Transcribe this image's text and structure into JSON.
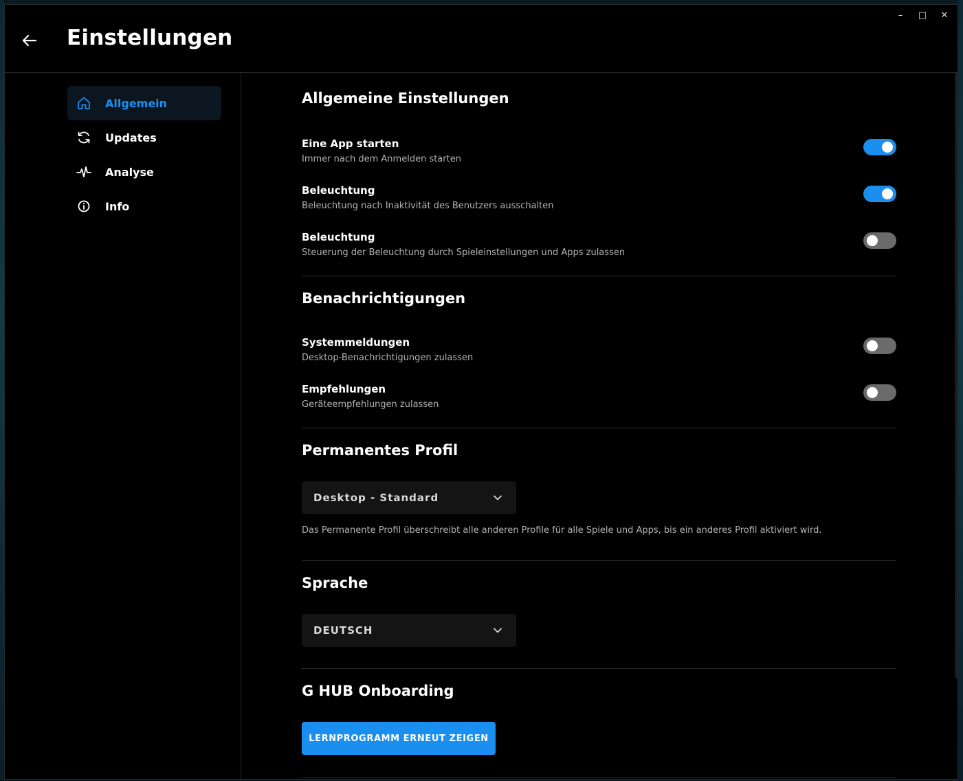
{
  "window": {
    "controls": {
      "minimize": "–",
      "maximize": "□",
      "close": "✕"
    }
  },
  "header": {
    "back_icon": "arrow-left-icon",
    "title": "Einstellungen"
  },
  "sidebar": {
    "items": [
      {
        "label": "Allgemein",
        "icon": "home-icon",
        "active": true
      },
      {
        "label": "Updates",
        "icon": "refresh-icon",
        "active": false
      },
      {
        "label": "Analyse",
        "icon": "pulse-icon",
        "active": false
      },
      {
        "label": "Info",
        "icon": "info-icon",
        "active": false
      }
    ]
  },
  "general": {
    "title": "Allgemeine Einstellungen",
    "settings": [
      {
        "label": "Eine App starten",
        "description": "Immer nach dem Anmelden starten",
        "enabled": true
      },
      {
        "label": "Beleuchtung",
        "description": "Beleuchtung nach Inaktivität des Benutzers ausschalten",
        "enabled": true
      },
      {
        "label": "Beleuchtung",
        "description": "Steuerung der Beleuchtung durch Spieleinstellungen und Apps zulassen",
        "enabled": false
      }
    ]
  },
  "notifications": {
    "title": "Benachrichtigungen",
    "settings": [
      {
        "label": "Systemmeldungen",
        "description": "Desktop-Benachrichtigungen zulassen",
        "enabled": false
      },
      {
        "label": "Empfehlungen",
        "description": "Geräteempfehlungen zulassen",
        "enabled": false
      }
    ]
  },
  "profile": {
    "title": "Permanentes Profil",
    "selected": "Desktop - Standard",
    "note": "Das Permanente Profil überschreibt alle anderen Profile für alle Spiele und Apps, bis ein anderes Profil aktiviert wird."
  },
  "language": {
    "title": "Sprache",
    "selected": "DEUTSCH"
  },
  "onboarding": {
    "title": "G HUB Onboarding",
    "button_label": "LERNPROGRAMM ERNEUT ZEIGEN"
  },
  "colors": {
    "accent": "#1a8ff0",
    "background": "#000000",
    "toggle_off": "#6b6b6b",
    "secondary_text": "#b3b3b3"
  }
}
